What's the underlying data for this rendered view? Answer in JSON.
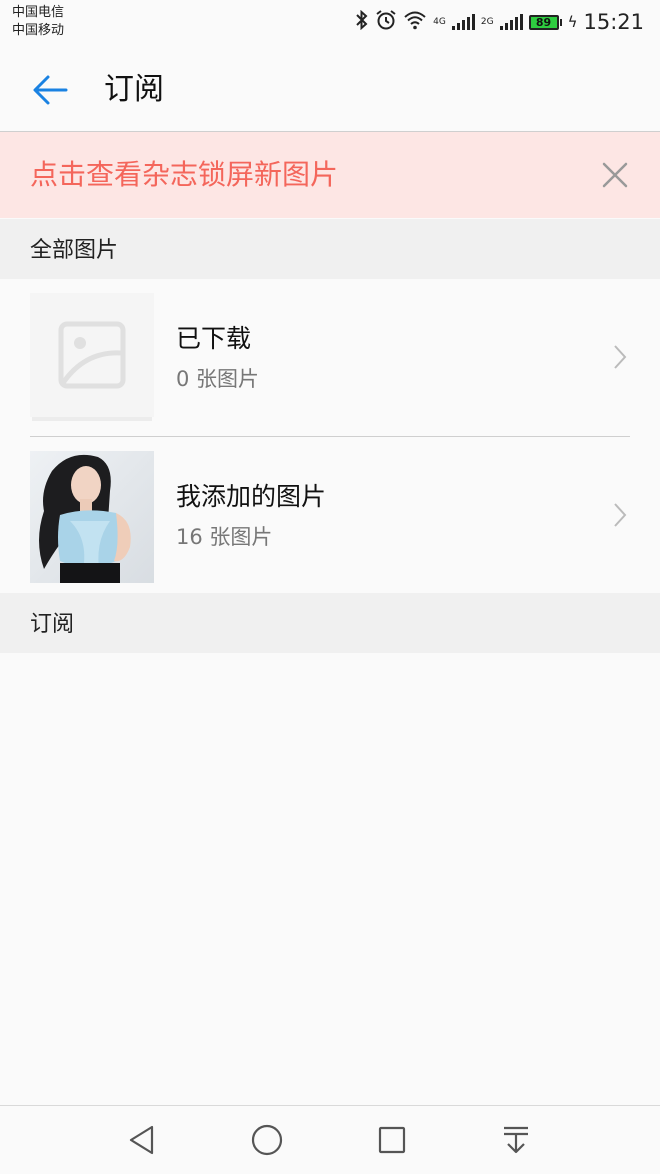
{
  "status_bar": {
    "carrier_1": "中国电信",
    "carrier_2": "中国移动",
    "net_label_1": "4G",
    "net_label_2": "2G",
    "battery": "89",
    "time": "15:21",
    "icons": [
      "bluetooth-icon",
      "alarm-icon",
      "wifi-icon",
      "signal-icon",
      "battery-icon",
      "charging-icon"
    ]
  },
  "header": {
    "title": "订阅",
    "back_icon": "arrow-left-icon"
  },
  "banner": {
    "text": "点击查看杂志锁屏新图片",
    "close_icon": "close-icon"
  },
  "sections": {
    "all_pictures": "全部图片",
    "subscriptions": "订阅"
  },
  "rows": [
    {
      "title": "已下载",
      "subtitle": "0 张图片",
      "thumb": "image-placeholder-icon"
    },
    {
      "title": "我添加的图片",
      "subtitle": "16 张图片",
      "thumb": "photo-thumbnail"
    }
  ],
  "colors": {
    "accent_blue": "#1a82e2",
    "banner_bg": "#fde6e4",
    "banner_text": "#f4665b",
    "battery_green": "#2ecc40"
  },
  "nav_bar": {
    "icons": [
      "back-triangle-icon",
      "home-circle-icon",
      "recents-square-icon",
      "notification-pull-icon"
    ]
  }
}
